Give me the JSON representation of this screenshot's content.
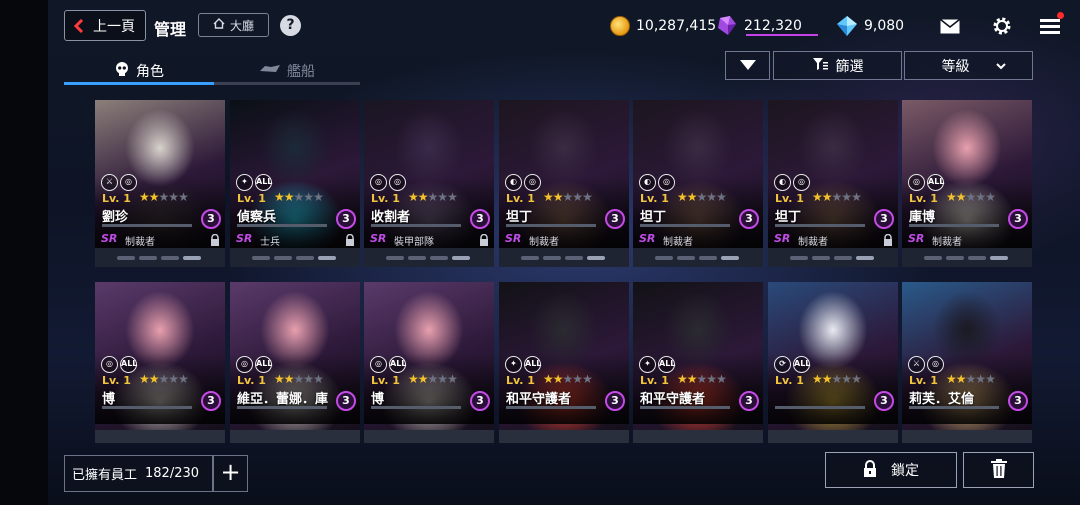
{
  "header": {
    "back_label": "上一頁",
    "title": "管理",
    "lobby_label": "大廳",
    "help_symbol": "?"
  },
  "currencies": {
    "credits": "10,287,415",
    "gems": "212,320",
    "crystals": "9,080"
  },
  "tabs": [
    {
      "label": "角色",
      "active": true
    },
    {
      "label": "艦船",
      "active": false
    }
  ],
  "toolbar": {
    "sort_toggle_icon": "triangle-down-icon",
    "filter_label": "篩選",
    "sort_label": "等級"
  },
  "cards": [
    {
      "name": "劉珍",
      "level": "Lv. 1",
      "stars": 2,
      "badge": "3",
      "rarity": "SR",
      "class": "制裁者",
      "roles": [
        "⚔",
        "◎"
      ],
      "locked": true,
      "art": [
        "#d9d2cc",
        "#8c7f7a",
        "#3a3035"
      ]
    },
    {
      "name": "偵察兵",
      "level": "Lv. 1",
      "stars": 2,
      "badge": "3",
      "rarity": "SR",
      "class": "士兵",
      "roles": [
        "✦",
        "ALL"
      ],
      "locked": true,
      "art": [
        "#1c2a38",
        "#0a1016",
        "#27b7d6"
      ]
    },
    {
      "name": "收割者",
      "level": "Lv. 1",
      "stars": 2,
      "badge": "3",
      "rarity": "SR",
      "class": "裝甲部隊",
      "roles": [
        "◎",
        "◎"
      ],
      "locked": true,
      "art": [
        "#3a2a4a",
        "#1a1622",
        "#6a5a7a"
      ]
    },
    {
      "name": "坦丁",
      "level": "Lv. 1",
      "stars": 2,
      "badge": "3",
      "rarity": "SR",
      "class": "制裁者",
      "roles": [
        "◐",
        "◎"
      ],
      "locked": false,
      "art": [
        "#3a2a42",
        "#1c161f",
        "#7a5a4a"
      ]
    },
    {
      "name": "坦丁",
      "level": "Lv. 1",
      "stars": 2,
      "badge": "3",
      "rarity": "SR",
      "class": "制裁者",
      "roles": [
        "◐",
        "◎"
      ],
      "locked": false,
      "art": [
        "#3a2a42",
        "#1c161f",
        "#7a5a4a"
      ]
    },
    {
      "name": "坦丁",
      "level": "Lv. 1",
      "stars": 2,
      "badge": "3",
      "rarity": "SR",
      "class": "制裁者",
      "roles": [
        "◐",
        "◎"
      ],
      "locked": true,
      "art": [
        "#3a2a42",
        "#1c161f",
        "#7a5a4a"
      ]
    },
    {
      "name": "庫博",
      "level": "Lv. 1",
      "stars": 2,
      "badge": "3",
      "rarity": "SR",
      "class": "制裁者",
      "roles": [
        "◎",
        "ALL"
      ],
      "locked": false,
      "art": [
        "#e8a0ae",
        "#7a5a66",
        "#cfc8c0"
      ]
    },
    {
      "name": "博",
      "level": "Lv. 1",
      "stars": 2,
      "badge": "3",
      "rarity": "",
      "class": "",
      "roles": [
        "◎",
        "ALL"
      ],
      "locked": false,
      "art": [
        "#e8a0ae",
        "#5a3a6a",
        "#cfc8c0"
      ]
    },
    {
      "name": "維亞．蕾娜．庫",
      "level": "Lv. 1",
      "stars": 2,
      "badge": "3",
      "rarity": "",
      "class": "",
      "roles": [
        "◎",
        "ALL"
      ],
      "locked": false,
      "art": [
        "#e8a0ae",
        "#5a3a6a",
        "#cfc8c0"
      ]
    },
    {
      "name": "博",
      "level": "Lv. 1",
      "stars": 2,
      "badge": "3",
      "rarity": "",
      "class": "",
      "roles": [
        "◎",
        "ALL"
      ],
      "locked": false,
      "art": [
        "#e8a0ae",
        "#5a3a6a",
        "#cfc8c0"
      ]
    },
    {
      "name": "和平守護者",
      "level": "Lv. 1",
      "stars": 2,
      "badge": "3",
      "rarity": "",
      "class": "",
      "roles": [
        "✦",
        "ALL"
      ],
      "locked": false,
      "art": [
        "#2a2a30",
        "#121216",
        "#e0412e"
      ]
    },
    {
      "name": "和平守護者",
      "level": "Lv. 1",
      "stars": 2,
      "badge": "3",
      "rarity": "",
      "class": "",
      "roles": [
        "✦",
        "ALL"
      ],
      "locked": false,
      "art": [
        "#2a2a30",
        "#121216",
        "#e0412e"
      ]
    },
    {
      "name": "",
      "level": "Lv. 1",
      "stars": 2,
      "badge": "3",
      "rarity": "",
      "class": "",
      "roles": [
        "⟳",
        "ALL"
      ],
      "locked": false,
      "art": [
        "#e8eaf2",
        "#2a4a7a",
        "#c4a33a"
      ]
    },
    {
      "name": "莉芙．艾倫",
      "level": "Lv. 1",
      "stars": 2,
      "badge": "3",
      "rarity": "",
      "class": "",
      "roles": [
        "⚔",
        "◎"
      ],
      "locked": false,
      "art": [
        "#1a1a22",
        "#2a5a8a",
        "#d8b070"
      ]
    }
  ],
  "bottom": {
    "owned_label": "已擁有員工",
    "owned_count": "182/230",
    "lock_label": "鎖定"
  },
  "colors": {
    "accent_blue": "#3aa0ff",
    "rarity_purple": "#c04ce6",
    "star_gold": "#f3c22b",
    "level_gold": "#f1c43d"
  }
}
